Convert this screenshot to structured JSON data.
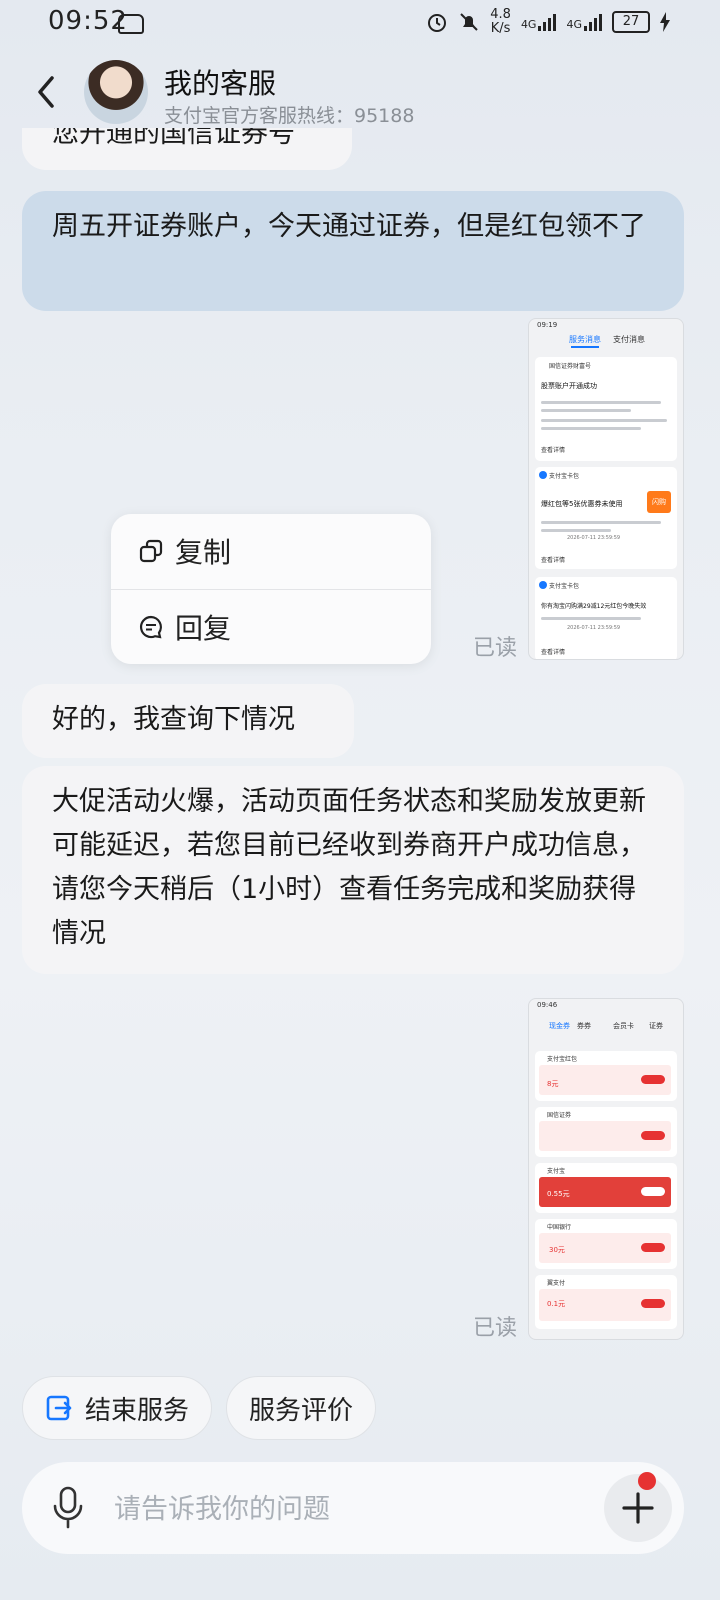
{
  "status_bar": {
    "time": "09:52",
    "net_speed_value": "4.8",
    "net_speed_unit": "K/s",
    "signal_1_label": "4G",
    "signal_2_label": "4G",
    "battery": "27"
  },
  "header": {
    "title": "我的客服",
    "subtitle": "支付宝官方客服热线：95188"
  },
  "messages": {
    "clipped_text": "您开通的国信证券号",
    "user_msg_1": "周五开证券账户，今天通过证券，但是红包领不了",
    "reply_1": "好的，我查询下情况",
    "reply_2": "大促活动火爆，活动页面任务状态和奖励发放更新可能延迟，若您目前已经收到券商开户成功信息，请您今天稍后（1小时）查看任务完成和奖励获得情况",
    "read_label_1": "已读",
    "read_label_2": "已读"
  },
  "thumb1": {
    "time": "09:19",
    "tab_active": "服务消息",
    "tab_other": "支付消息",
    "card1_source": "国信证券财富号",
    "card1_title": "股票账户开通成功",
    "card1_link": "查看详情",
    "card2_source": "支付宝卡包",
    "card2_title": "爆红包等5张优惠券未使用",
    "card2_badge": "闪购",
    "card2_date": "2026-07-11 23:59:59",
    "card2_link": "查看详情",
    "card3_source": "支付宝卡包",
    "card3_title": "你有淘宝闪购满29减12元红包今晚失效",
    "card3_date": "2026-07-11 23:59:59",
    "card3_link": "查看详情"
  },
  "thumb2": {
    "time": "09:46",
    "tab_active": "现金券",
    "tab_2": "券券",
    "tab_3": "会员卡",
    "tab_4": "证券",
    "row1_source": "支付宝红包",
    "row1_amount": "8元",
    "row2_source": "国信证券",
    "row3_source": "支付宝",
    "row3_amount": "0.55元",
    "row4_source": "中国银行",
    "row4_amount": "30元",
    "row5_source": "翼支付",
    "row5_amount": "0.1元"
  },
  "context_menu": {
    "copy": "复制",
    "reply": "回复"
  },
  "quick_actions": {
    "end_service": "结束服务",
    "rate_service": "服务评价"
  },
  "input": {
    "placeholder": "请告诉我你的问题"
  },
  "colors": {
    "accent_blue": "#1677ff",
    "user_bubble": "#ccdbea",
    "notification_red": "#e63232"
  }
}
